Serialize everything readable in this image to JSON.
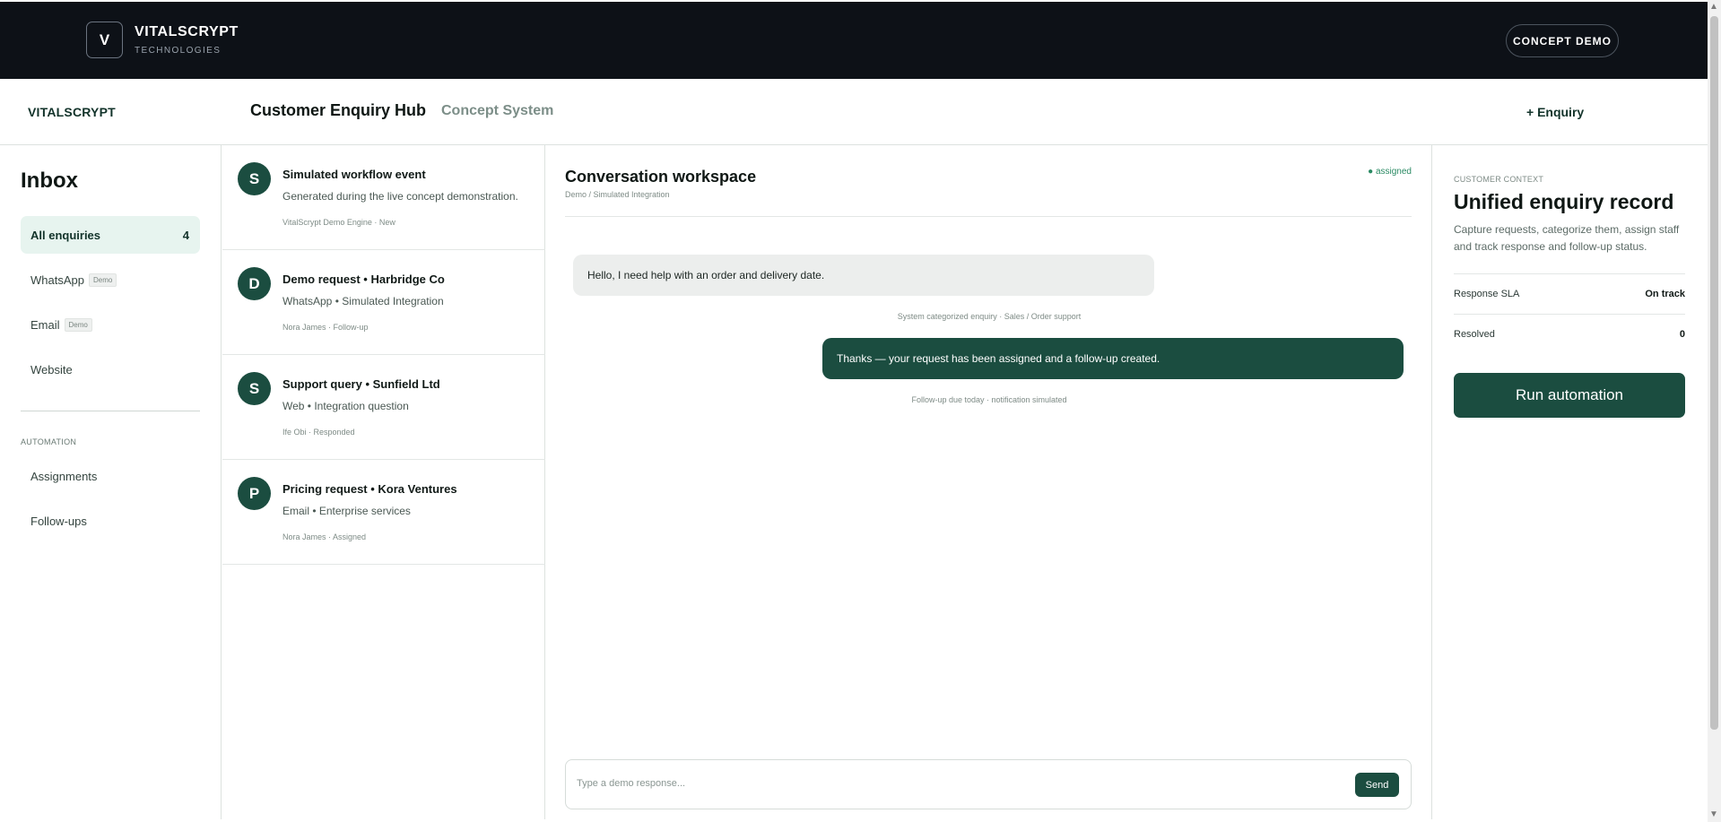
{
  "brand": {
    "logo_letter": "V",
    "name": "VITALSCRYPT",
    "sub": "TECHNOLOGIES",
    "concept_button": "CONCEPT DEMO"
  },
  "header": {
    "app_logo": "VITALSCRYPT",
    "title": "Customer Enquiry Hub",
    "subtitle": "Concept System",
    "new_enquiry": "+ Enquiry"
  },
  "sidebar": {
    "title": "Inbox",
    "items": [
      {
        "label": "All enquiries",
        "count": "4"
      },
      {
        "label": "WhatsApp",
        "tag": "Demo"
      },
      {
        "label": "Email",
        "tag": "Demo"
      },
      {
        "label": "Website"
      }
    ],
    "section_label": "AUTOMATION",
    "automation_items": [
      {
        "label": "Assignments"
      },
      {
        "label": "Follow-ups"
      }
    ]
  },
  "enquiries": [
    {
      "initial": "S",
      "title": "Simulated workflow event",
      "subtitle": "Generated during the live concept demonstration.",
      "meta": "VitalScrypt Demo Engine · New"
    },
    {
      "initial": "D",
      "title": "Demo request • Harbridge Co",
      "subtitle": "WhatsApp • Simulated Integration",
      "meta": "Nora James · Follow-up"
    },
    {
      "initial": "S",
      "title": "Support query • Sunfield Ltd",
      "subtitle": "Web • Integration question",
      "meta": "Ife Obi · Responded"
    },
    {
      "initial": "P",
      "title": "Pricing request • Kora Ventures",
      "subtitle": "Email • Enterprise services",
      "meta": "Nora James · Assigned"
    }
  ],
  "conversation": {
    "title": "Conversation workspace",
    "crumb": "Demo / Simulated Integration",
    "status": "● assigned",
    "message_in": "Hello, I need help with an order and delivery date.",
    "system_note": "System categorized enquiry · Sales / Order support",
    "message_out": "Thanks — your request has been assigned and a follow-up created.",
    "followup_note": "Follow-up due today · notification simulated",
    "composer_placeholder": "Type a demo response...",
    "send_label": "Send"
  },
  "context": {
    "kicker": "CUSTOMER CONTEXT",
    "title": "Unified enquiry record",
    "description": "Capture requests, categorize them, assign staff and track response and follow-up status.",
    "sla_label": "Response SLA",
    "sla_value": "On track",
    "resolved_label": "Resolved",
    "resolved_value": "0",
    "run_button": "Run automation"
  },
  "colors": {
    "accent": "#1b4d40",
    "topbar": "#0d1117",
    "active_bg": "#e7f4ef",
    "status": "#2a8a63"
  }
}
